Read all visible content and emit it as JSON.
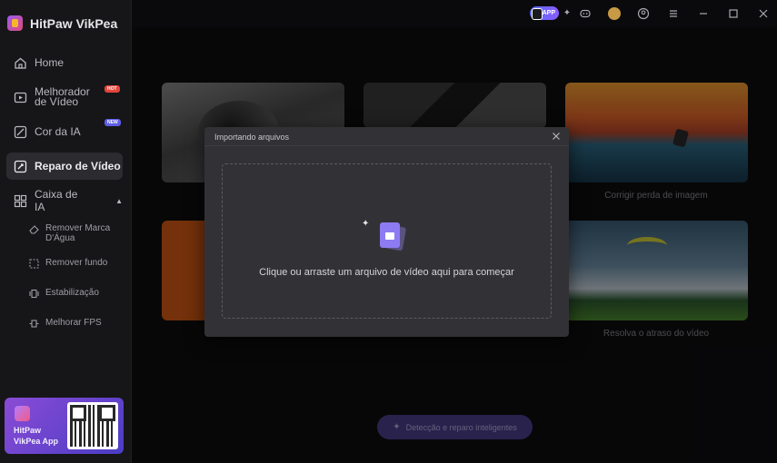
{
  "app": {
    "name": "HitPaw VikPea"
  },
  "sidebar": {
    "items": [
      {
        "label": "Home"
      },
      {
        "label": "Melhorador de Vídeo",
        "badge": "HOT"
      },
      {
        "label": "Cor da IA",
        "badge": "NEW"
      },
      {
        "label": "Reparo de Vídeo",
        "active": true
      },
      {
        "label": "Caixa de IA",
        "expanded": true
      }
    ],
    "subitems": [
      {
        "label": "Remover Marca D'Água"
      },
      {
        "label": "Remover fundo"
      },
      {
        "label": "Estabilização"
      },
      {
        "label": "Melhorar FPS"
      }
    ],
    "promo": {
      "line1": "HitPaw",
      "line2": "VikPea App"
    }
  },
  "topbar": {
    "app_pill": "APP"
  },
  "cards": [
    {
      "caption": ""
    },
    {
      "caption": ""
    },
    {
      "caption": "Corrigir perda de imagem"
    },
    {
      "caption": ""
    },
    {
      "caption": "Resolva o atraso do vídeo"
    }
  ],
  "bottom_button": {
    "label": "Detecção e reparo inteligentes"
  },
  "modal": {
    "title": "Importando arquivos",
    "drop_text": "Clique ou arraste um arquivo de vídeo aqui para começar"
  },
  "colors": {
    "accent": "#8c7bf2",
    "hot": "#e2453c",
    "new": "#5e5ee6"
  }
}
